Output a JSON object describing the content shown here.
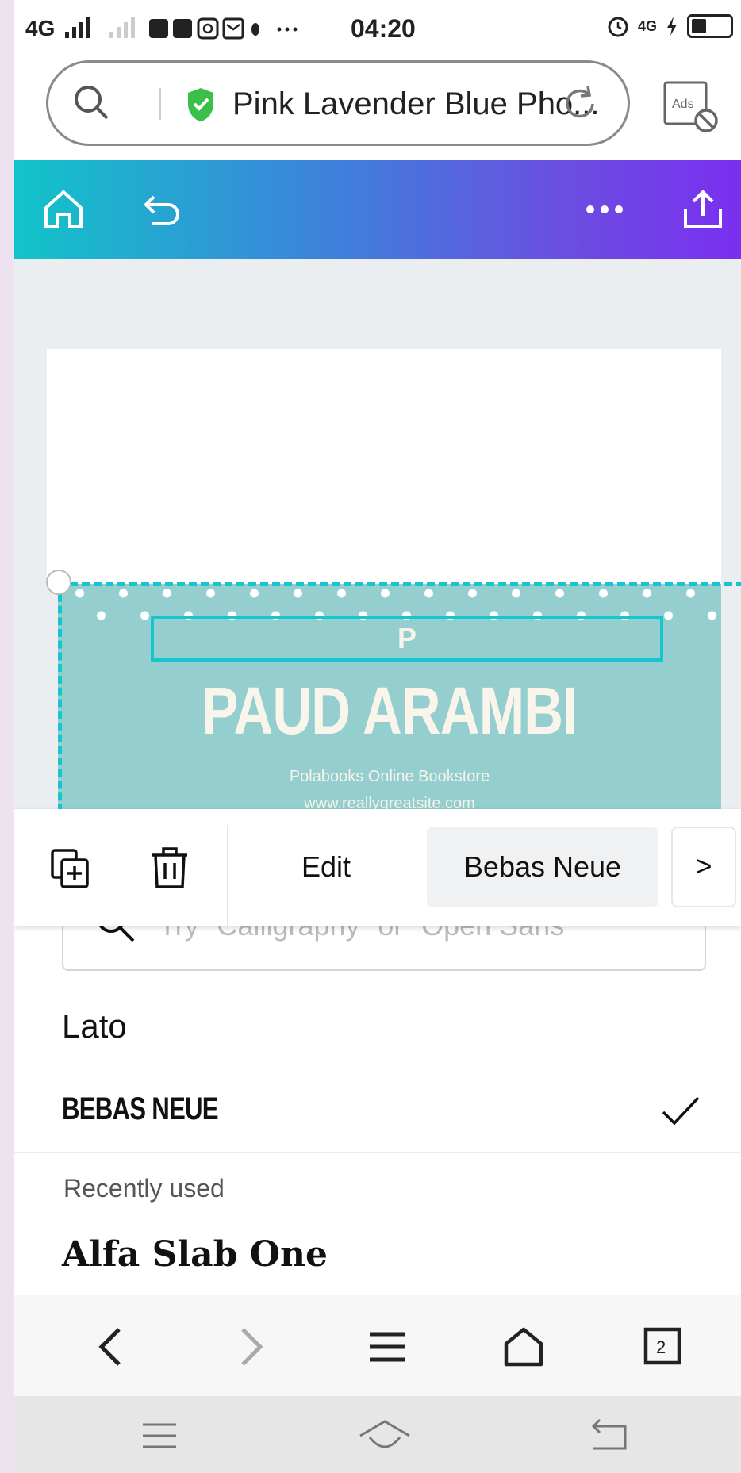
{
  "status_bar": {
    "signal": "4G",
    "notification_icons": "☐ ☐ ☐ ☐ ✱ ···",
    "time": "04:20",
    "network": "4G"
  },
  "browser": {
    "page_title": "Pink Lavender Blue Pho...",
    "ads_label": "Ads"
  },
  "design": {
    "placeholder_letter": "P",
    "headline": "PAUD ARAMBI",
    "subtitle": "Polabooks Online Bookstore",
    "website": "www.reallygreatsite.com"
  },
  "text_toolbar": {
    "edit_label": "Edit",
    "current_font": "Bebas Neue",
    "next_label": ">"
  },
  "font_panel": {
    "search_placeholder": "Try \"Calligraphy\" or \"Open Sans\"",
    "fonts": [
      "Lato",
      "BEBAS NEUE"
    ],
    "selected_font": "BEBAS NEUE",
    "recently_used_label": "Recently used",
    "recent_fonts": [
      "Alfa Slab One"
    ]
  },
  "browser_nav": {
    "tab_count": "2"
  },
  "colors": {
    "toolbar_gradient_start": "#12c4c9",
    "toolbar_gradient_end": "#7b2ff0",
    "design_teal": "#94cecf",
    "selection": "#16c6cf"
  }
}
